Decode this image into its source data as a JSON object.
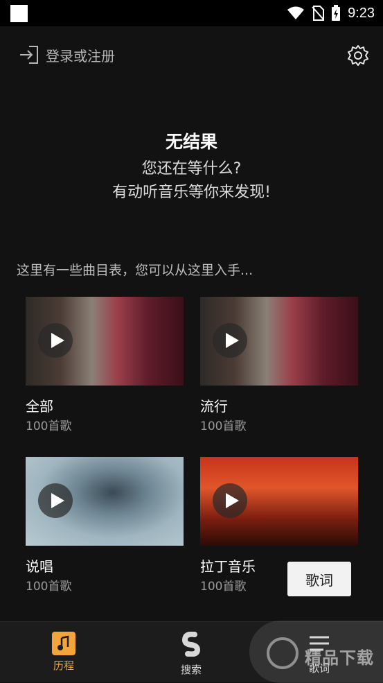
{
  "status_bar": {
    "time": "9:23"
  },
  "header": {
    "login_label": "登录或注册"
  },
  "empty_state": {
    "title": "无结果",
    "line1": "您还在等什么?",
    "line2": "有动听音乐等你来发现!"
  },
  "section_title": "这里有一些曲目表，您可以从这里入手...",
  "playlists": [
    {
      "title": "全部",
      "count": "100首歌"
    },
    {
      "title": "流行",
      "count": "100首歌"
    },
    {
      "title": "说唱",
      "count": "100首歌"
    },
    {
      "title": "拉丁音乐",
      "count": "100首歌"
    }
  ],
  "lyrics_button": "歌词",
  "bottom_nav": [
    {
      "label": "历程",
      "icon": "history-note-icon",
      "active": true
    },
    {
      "label": "搜索",
      "icon": "search-s-icon",
      "active": false
    },
    {
      "label": "歌词",
      "icon": "lyrics-lines-icon",
      "active": false
    }
  ],
  "watermark": "精品下载",
  "colors": {
    "accent": "#f3a53a",
    "background": "#121212",
    "nav_bg": "#1c1c1c"
  }
}
